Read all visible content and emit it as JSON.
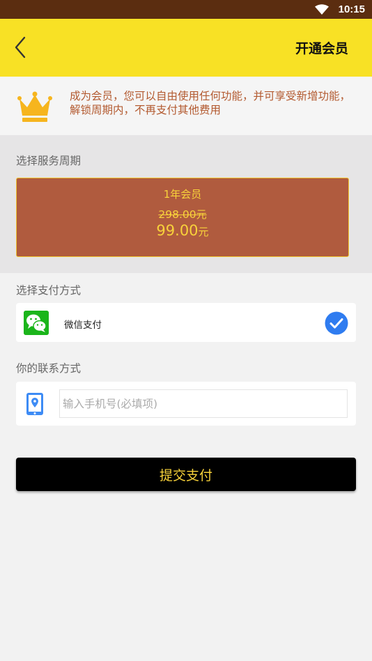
{
  "status_bar": {
    "time": "10:15"
  },
  "app_bar": {
    "title": "开通会员"
  },
  "notice": {
    "text": "成为会员，您可以自由使用任何功能，并可享受新增功能，解锁周期内，不再支付其他费用"
  },
  "period": {
    "label": "选择服务周期",
    "plan": {
      "name": "1年会员",
      "original_price": "298.00",
      "price": "99.00",
      "unit": "元"
    }
  },
  "payment": {
    "label": "选择支付方式",
    "method_label": "微信支付"
  },
  "contact": {
    "label": "你的联系方式",
    "phone_placeholder": "输入手机号(必填项)",
    "phone_value": ""
  },
  "submit": {
    "label": "提交支付"
  },
  "colors": {
    "status_bar": "#5b2d10",
    "app_bar": "#f8e125",
    "plan_card": "#b05b3e",
    "plan_text": "#f8d23a",
    "notice_text": "#b35a30",
    "wechat": "#1bb51b",
    "check": "#2f7cf0",
    "submit_bg": "#000000"
  },
  "icons": [
    "wifi-icon",
    "back-icon",
    "crown-icon",
    "wechat-icon",
    "check-icon",
    "phone-location-icon"
  ]
}
